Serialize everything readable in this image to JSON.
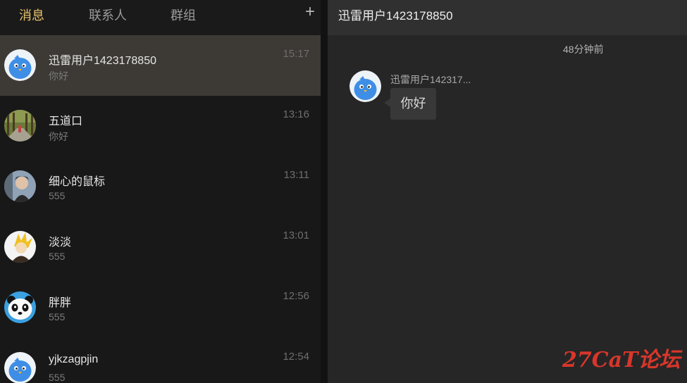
{
  "tabs": [
    {
      "label": "消息",
      "active": true
    },
    {
      "label": "联系人",
      "active": false
    },
    {
      "label": "群组",
      "active": false
    }
  ],
  "add_button": {
    "label": "+"
  },
  "conversations": [
    {
      "name": "迅雷用户1423178850",
      "preview": "你好",
      "time": "15:17",
      "selected": true,
      "avatar": "blue-bird-avatar"
    },
    {
      "name": "五道口",
      "preview": "你好",
      "time": "13:16",
      "selected": false,
      "avatar": "photo-road-avatar"
    },
    {
      "name": "细心的鼠标",
      "preview": "555",
      "time": "13:11",
      "selected": false,
      "avatar": "photo-person-avatar"
    },
    {
      "name": "淡淡",
      "preview": "555",
      "time": "13:01",
      "selected": false,
      "avatar": "yellow-anime-avatar"
    },
    {
      "name": "胖胖",
      "preview": "555",
      "time": "12:56",
      "selected": false,
      "avatar": "panda-avatar"
    },
    {
      "name": "yjkzagpjin",
      "preview": "555",
      "time": "12:54",
      "selected": false,
      "avatar": "blue-bird-avatar"
    }
  ],
  "chat": {
    "title": "迅雷用户1423178850",
    "messages": [
      {
        "time": "48分钟前",
        "sender": "迅雷用户142317...",
        "text": "你好",
        "avatar": "blue-bird-avatar"
      }
    ]
  },
  "watermark": {
    "text": "27CaT论坛"
  },
  "colors": {
    "accent_tab": "#e8c36a",
    "selected_row": "#3d3a36",
    "watermark": "#d9362b",
    "bird_blue": "#3f8ee6"
  }
}
